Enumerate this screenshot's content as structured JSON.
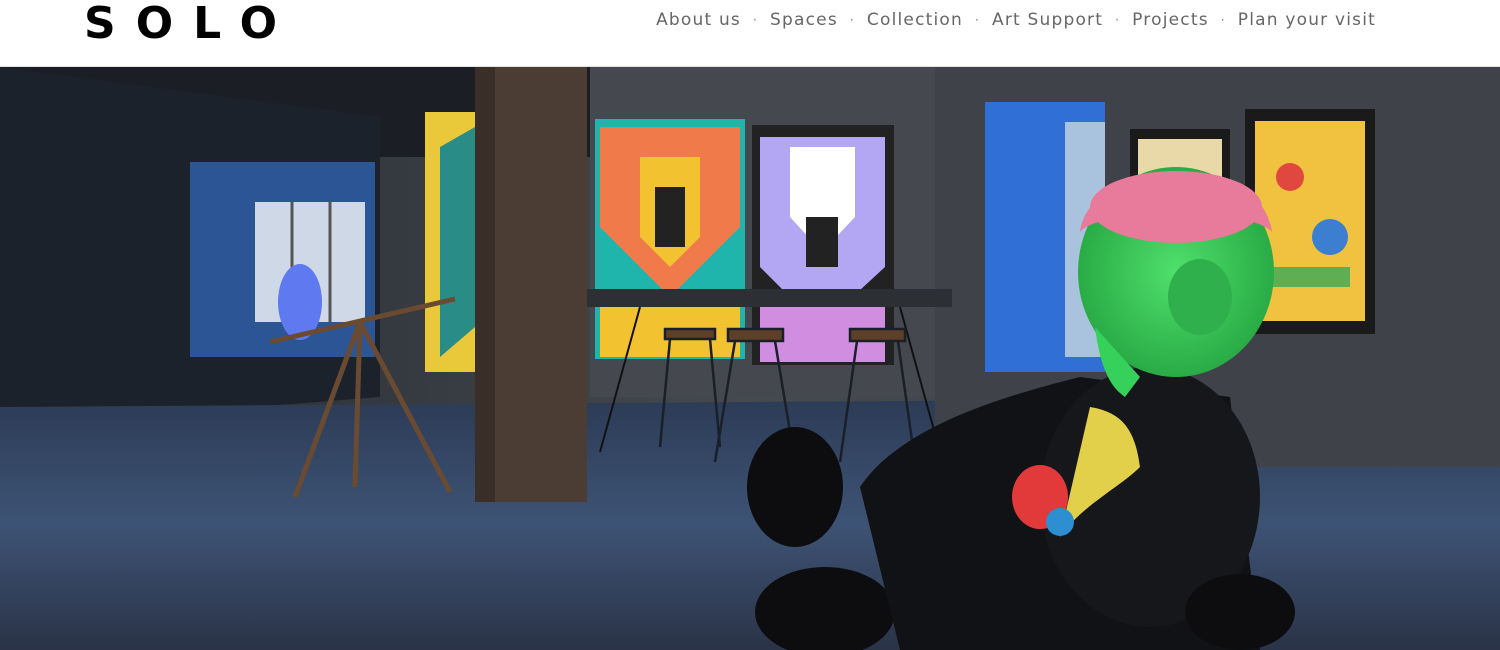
{
  "site": {
    "logo_text": "SOLO"
  },
  "nav": {
    "separator": "·",
    "items": [
      {
        "label": "About us"
      },
      {
        "label": "Spaces"
      },
      {
        "label": "Collection"
      },
      {
        "label": "Art Support"
      },
      {
        "label": "Projects"
      },
      {
        "label": "Plan your visit"
      }
    ]
  },
  "hero": {
    "image_alt": "",
    "colors": {
      "floor": "#3b4d6b",
      "wall": "#3a3f45",
      "accent_blue": "#2f6fd6",
      "sculpture_black": "#0d0d0f",
      "brain_pink": "#e87a9b",
      "head_green": "#36d15a"
    }
  }
}
